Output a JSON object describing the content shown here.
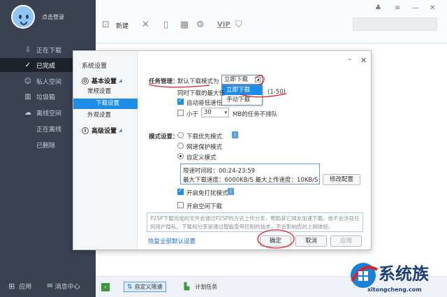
{
  "sidebar": {
    "login": "点击登录",
    "items": [
      {
        "label": "正在下载",
        "icon": "download-icon"
      },
      {
        "label": "已完成",
        "icon": "check-circle-icon"
      },
      {
        "label": "私人空间",
        "icon": "person-icon"
      },
      {
        "label": "垃圾箱",
        "icon": "trash-icon"
      },
      {
        "label": "离线空间",
        "icon": "cloud-icon"
      },
      {
        "label": "正在离线"
      },
      {
        "label": "已删除"
      }
    ],
    "bottom_apps": "应用",
    "bottom_msg": "消息中心"
  },
  "toolbar": {
    "new_label": "新建",
    "vip_label": "VIP"
  },
  "statusbar": {
    "custom_limit": "自定义限速",
    "plan_task": "计划任务"
  },
  "dialog": {
    "title": "系统设置",
    "sections": {
      "basic": "基本设置",
      "advanced": "高级设置"
    },
    "nav": [
      "常规设置",
      "下载设置",
      "外观设置"
    ],
    "task_mgmt_label": "任务管理：",
    "default_mode_label": "默认下载模式为",
    "mode_selected": "立即下载",
    "dropdown_options": [
      "立即下载",
      "手动下载"
    ],
    "max_tasks_label": "同时下载的最大任",
    "max_tasks_range": "(1-50)",
    "auto_lower_label": "自动将低速任",
    "less_than_label": "小于",
    "less_than_value": "30",
    "mb_label": "MB的任务不排队",
    "mode_settings_label": "模式设置：",
    "mode_download_first": "下载优先模式",
    "mode_net_protect": "网速保护模式",
    "mode_custom": "自定义模式",
    "limit_time": "限速时间段：00:24-23:59",
    "limit_speeds": "最大下载速度：6000KB/S   最大上传速度：10KB/S",
    "modify_btn": "修改配置",
    "no_disturb": "开启免打扰模式",
    "idle_download": "开启空闲下载",
    "note": "P2SP下载完成的文件会通过P2SP的方式上传分享，帮助其它网友加速下载，绝不会涉及任何用户隐私。下载和分享是通过智能宽带控制的技术，不会影响您的上网体验。",
    "restore_link": "恢复全部默认设置",
    "ok_btn": "确定",
    "cancel_btn": "取消",
    "apply_btn": "应用"
  },
  "watermark": {
    "brand": "系统族",
    "url": "xitongcheng.com"
  }
}
